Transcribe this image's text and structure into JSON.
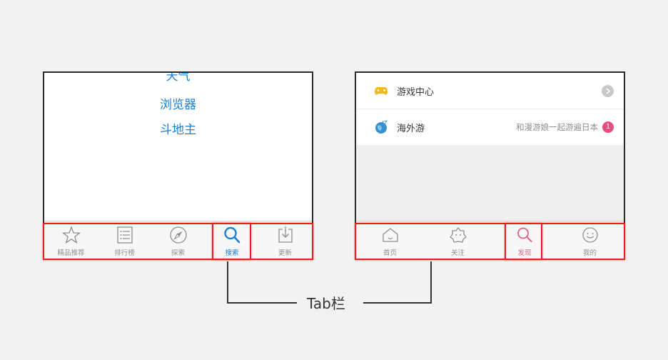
{
  "left_phone": {
    "search_words": [
      "天气",
      "浏览器",
      "斗地主"
    ],
    "tabs": [
      {
        "label": "精品推荐",
        "icon": "star-icon",
        "active": false
      },
      {
        "label": "排行榜",
        "icon": "list-icon",
        "active": false
      },
      {
        "label": "探索",
        "icon": "compass-icon",
        "active": false
      },
      {
        "label": "搜索",
        "icon": "search-icon",
        "active": true
      },
      {
        "label": "更新",
        "icon": "download-icon",
        "active": false
      }
    ],
    "accent": "#1a7fd6"
  },
  "right_phone": {
    "rows": [
      {
        "label": "游戏中心",
        "icon": "gamepad-icon",
        "side_text": "",
        "badge": ""
      },
      {
        "label": "海外游",
        "icon": "airplane-globe-icon",
        "side_text": "和漫游娘一起游遍日本",
        "badge": "1"
      }
    ],
    "tabs": [
      {
        "label": "首页",
        "icon": "home-icon",
        "active": false
      },
      {
        "label": "关注",
        "icon": "star-face-icon",
        "active": false
      },
      {
        "label": "发现",
        "icon": "search-icon",
        "active": true
      },
      {
        "label": "我的",
        "icon": "smiley-icon",
        "active": false
      }
    ],
    "accent": "#e0608a"
  },
  "caption": "Tab栏",
  "highlight_color": "#e81e1e"
}
